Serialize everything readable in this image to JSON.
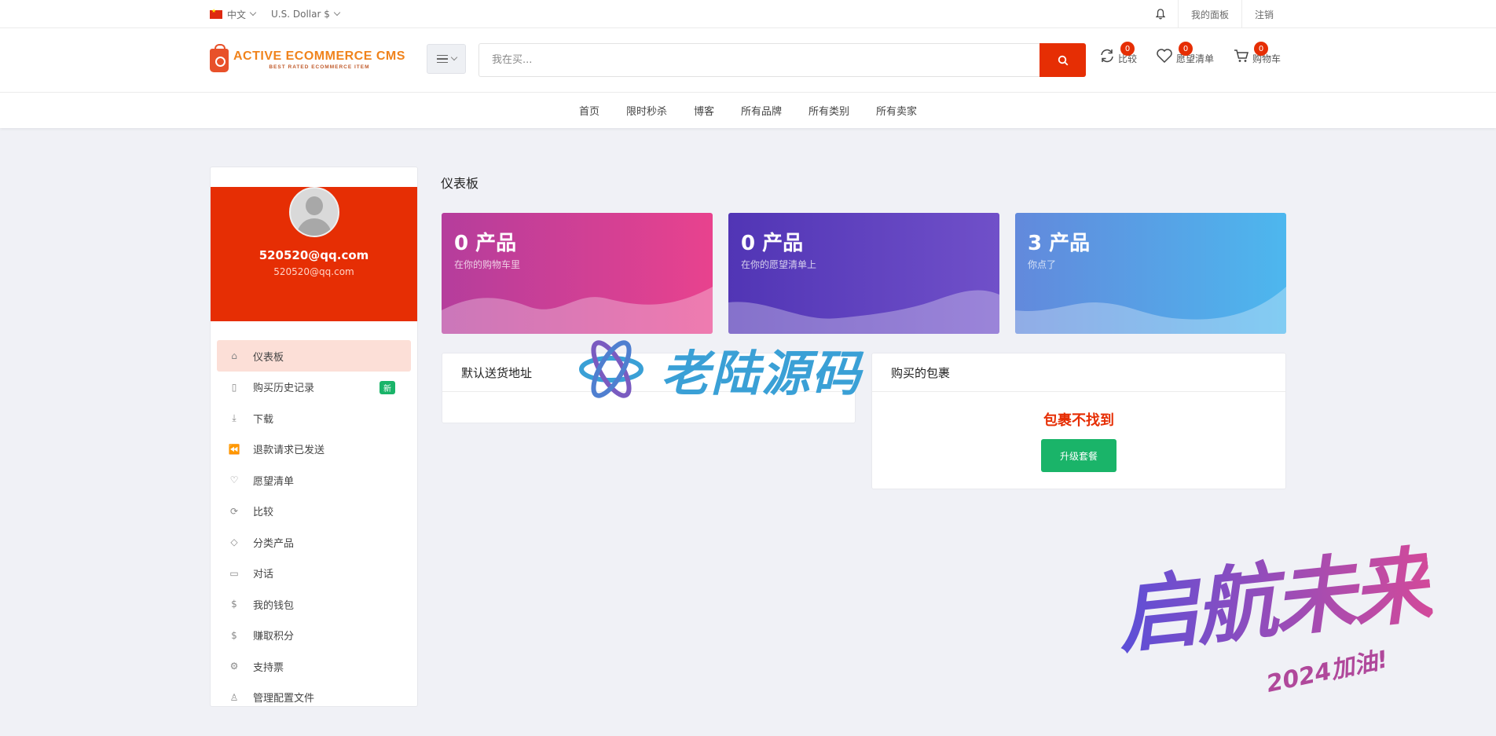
{
  "topbar": {
    "language": "中文",
    "currency": "U.S. Dollar $",
    "my_panel": "我的面板",
    "logout": "注销"
  },
  "header": {
    "logo_title": "ACTIVE ECOMMERCE CMS",
    "logo_subtitle": "BEST RATED ECOMMERCE ITEM",
    "search_placeholder": "我在买...",
    "compare_label": "比较",
    "compare_count": "0",
    "wishlist_label": "愿望清单",
    "wishlist_count": "0",
    "cart_label": "购物车",
    "cart_count": "0"
  },
  "nav": [
    "首页",
    "限时秒杀",
    "博客",
    "所有品牌",
    "所有类别",
    "所有卖家"
  ],
  "sidebar": {
    "email": "520520@qq.com",
    "email_sub": "520520@qq.com",
    "new_badge": "新",
    "items": [
      {
        "label": "仪表板",
        "icon": "home-icon"
      },
      {
        "label": "购买历史记录",
        "icon": "file-icon"
      },
      {
        "label": "下载",
        "icon": "download-icon"
      },
      {
        "label": "退款请求已发送",
        "icon": "backward-icon"
      },
      {
        "label": "愿望清单",
        "icon": "heart-icon"
      },
      {
        "label": "比较",
        "icon": "refresh-icon"
      },
      {
        "label": "分类产品",
        "icon": "diamond-icon"
      },
      {
        "label": "对话",
        "icon": "chat-icon"
      },
      {
        "label": "我的钱包",
        "icon": "dollar-icon"
      },
      {
        "label": "赚取积分",
        "icon": "dollar-icon"
      },
      {
        "label": "支持票",
        "icon": "support-icon"
      },
      {
        "label": "管理配置文件",
        "icon": "user-icon"
      }
    ]
  },
  "main": {
    "title": "仪表板",
    "cards": [
      {
        "value": "0 产品",
        "caption": "在你的购物车里"
      },
      {
        "value": "0 产品",
        "caption": "在你的愿望清单上"
      },
      {
        "value": "3 产品",
        "caption": "你点了"
      }
    ],
    "default_address_title": "默认送货地址",
    "package_title": "购买的包裹",
    "package_not_found": "包裹不找到",
    "upgrade_label": "升级套餐"
  },
  "watermark": {
    "center_text": "老陆源码",
    "corner_text": "启航未来",
    "corner_sub": "2024加油!"
  },
  "colors": {
    "primary": "#e62e04",
    "success": "#1ab469"
  }
}
